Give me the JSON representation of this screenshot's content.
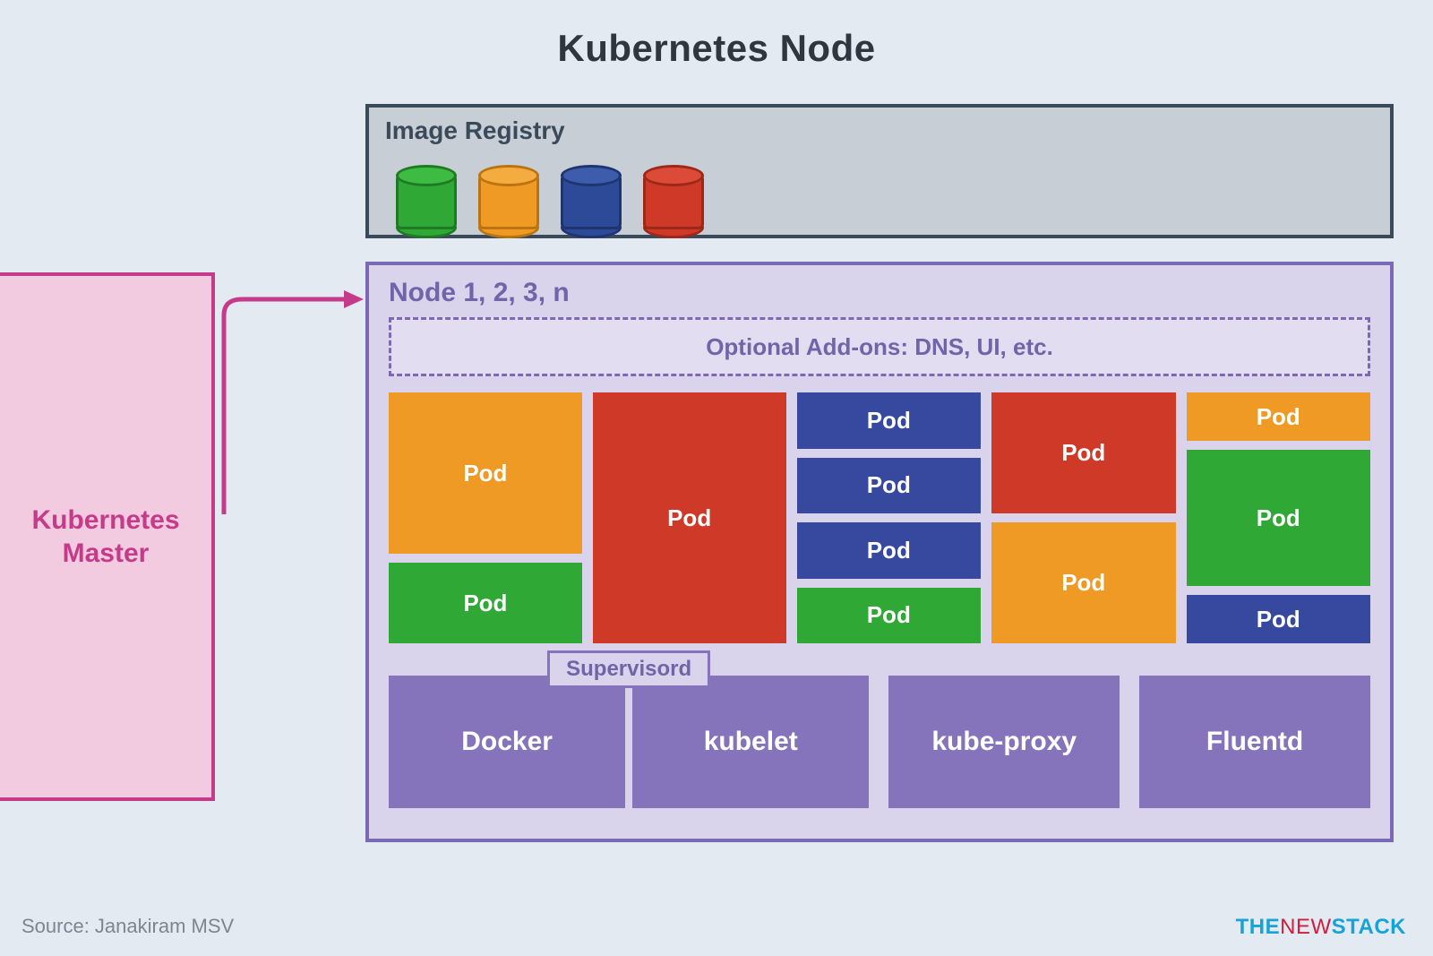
{
  "title": "Kubernetes Node",
  "registry": {
    "title": "Image Registry",
    "cylinders": [
      "green",
      "orange",
      "blue",
      "red"
    ]
  },
  "master": {
    "label": "Kubernetes\nMaster"
  },
  "node": {
    "title": "Node 1, 2, 3, n",
    "addons": "Optional Add-ons: DNS, UI, etc.",
    "pod_label": "Pod",
    "columns": [
      {
        "items": [
          {
            "color": "orange",
            "h": "2x"
          },
          {
            "color": "green",
            "h": "half"
          }
        ]
      },
      {
        "items": [
          {
            "color": "red",
            "h": "full"
          }
        ]
      },
      {
        "items": [
          {
            "color": "blue",
            "h": "q"
          },
          {
            "color": "blue",
            "h": "q"
          },
          {
            "color": "blue",
            "h": "q"
          },
          {
            "color": "green",
            "h": "q"
          }
        ]
      },
      {
        "items": [
          {
            "color": "red",
            "h": "half"
          },
          {
            "color": "orange",
            "h": "half"
          }
        ]
      },
      {
        "items": [
          {
            "color": "orange",
            "h": "s"
          },
          {
            "color": "green",
            "h": "2x"
          },
          {
            "color": "blue",
            "h": "s"
          }
        ]
      }
    ],
    "supervisord": "Supervisord",
    "services": [
      "Docker",
      "kubelet",
      "kube-proxy",
      "Fluentd"
    ]
  },
  "footer": {
    "source": "Source: Janakiram MSV",
    "brand": {
      "b1": "THE",
      "b2": "NEW",
      "b3": "STACK"
    }
  },
  "colors": {
    "orange": "#ee9a24",
    "green": "#2fa836",
    "red": "#ce3a27",
    "blue": "#37499e",
    "purple": "#8574bb",
    "pink": "#c63a8a"
  }
}
